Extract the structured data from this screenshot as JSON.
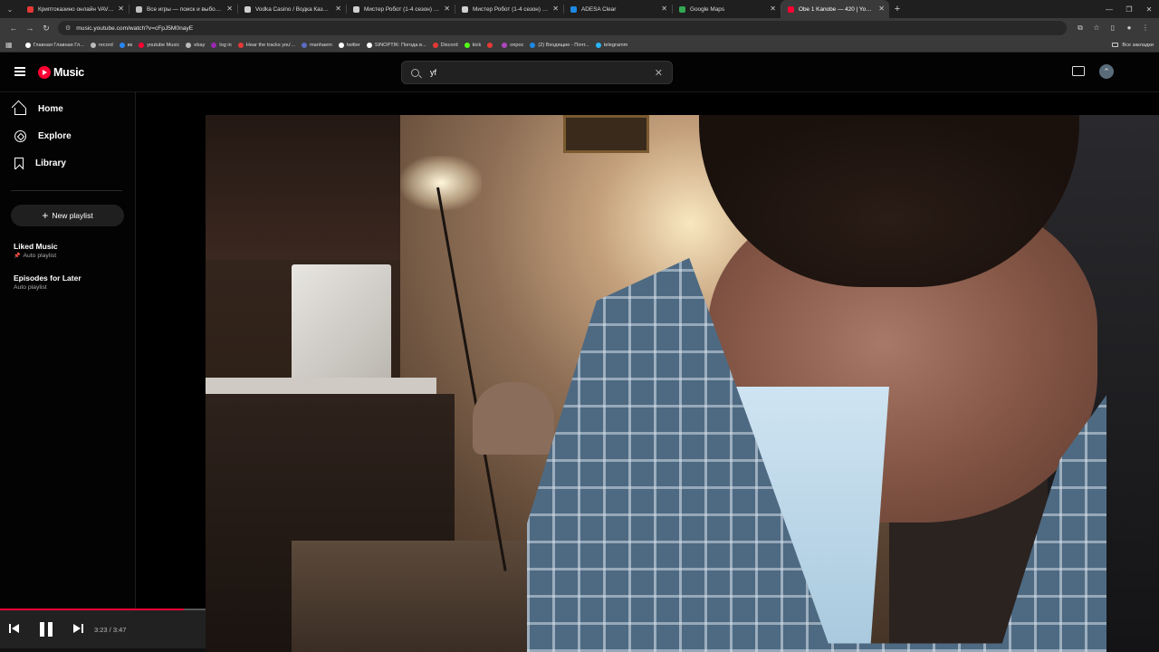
{
  "browser": {
    "tabs": [
      {
        "title": "Криптоказино онлайн VAVADA",
        "color": "#e53935"
      },
      {
        "title": "Все игры — поиск и выбор и",
        "color": "#c0c0c0"
      },
      {
        "title": "Vodka Casino / Водка Казино",
        "color": "#d0d0d0"
      },
      {
        "title": "Мистер Робот (1-4 сезон) смо",
        "color": "#d0d0d0"
      },
      {
        "title": "Мистер Робот (1-4 сезон) смо",
        "color": "#d0d0d0"
      },
      {
        "title": "ADESA Clear",
        "color": "#1e88e5"
      },
      {
        "title": "Google Maps",
        "color": "#34a853"
      },
      {
        "title": "Obe 1 Kanobe — 420 | YouTube",
        "color": "#ff0033",
        "active": true
      }
    ],
    "url": "music.youtube.com/watch?v=cFpJ5M0nayE",
    "bookmarks": [
      {
        "label": "Главная Главная Гл...",
        "color": "#ffffff"
      },
      {
        "label": "record",
        "color": "#bbbbbb"
      },
      {
        "label": "вк",
        "color": "#2787f5"
      },
      {
        "label": "youtube Music",
        "color": "#ff0033"
      },
      {
        "label": "ebay",
        "color": "#bbbbbb"
      },
      {
        "label": "log in",
        "color": "#9c27b0"
      },
      {
        "label": "Hear the tracks you'...",
        "color": "#e53935"
      },
      {
        "label": "manhaem",
        "color": "#5c6bc0"
      },
      {
        "label": "twitter",
        "color": "#ffffff"
      },
      {
        "label": "SINOPTIK: Погода в...",
        "color": "#ffffff"
      },
      {
        "label": "Discord",
        "color": "#e53935"
      },
      {
        "label": "kick",
        "color": "#53fc18"
      },
      {
        "label": "",
        "color": "#e53935"
      },
      {
        "label": "опрос",
        "color": "#ab47bc"
      },
      {
        "label": "(2) Входящие - Почт...",
        "color": "#1e88e5"
      },
      {
        "label": "telegramm",
        "color": "#29b6f6"
      }
    ],
    "all_bookmarks": "Все закладки"
  },
  "header": {
    "logo_text": "Music",
    "search_value": "yf"
  },
  "sidebar": {
    "nav": [
      {
        "label": "Home"
      },
      {
        "label": "Explore"
      },
      {
        "label": "Library"
      }
    ],
    "new_playlist": "New playlist",
    "playlists": [
      {
        "name": "Liked Music",
        "sub": "Auto playlist",
        "pinned": true
      },
      {
        "name": "Episodes for Later",
        "sub": "Auto playlist",
        "pinned": false
      }
    ]
  },
  "player": {
    "time": "3:23 / 3:47",
    "progress": 0.894
  },
  "colors": {
    "accent": "#ff0033",
    "background": "#030303"
  }
}
